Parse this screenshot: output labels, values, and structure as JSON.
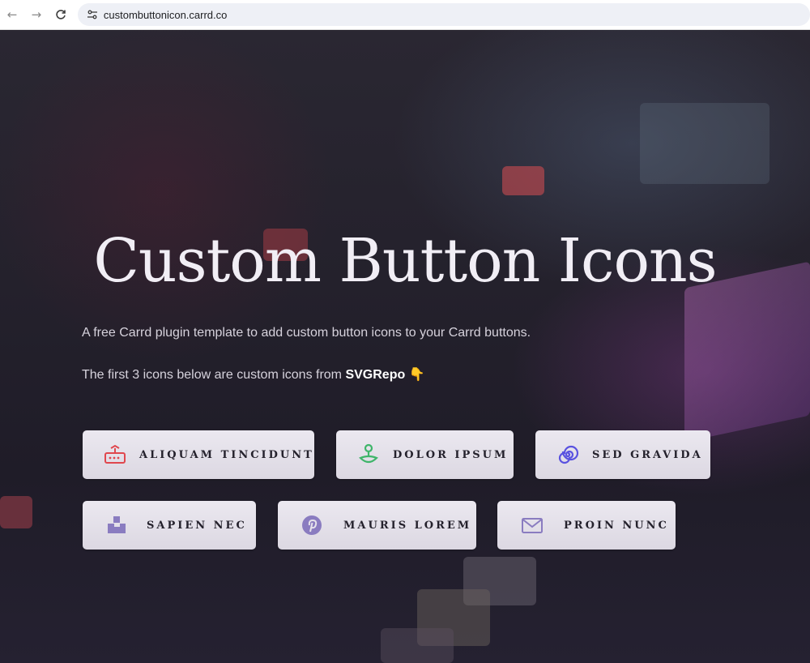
{
  "browser": {
    "url": "custombuttonicon.carrd.co"
  },
  "hero": {
    "title": "Custom Button Icons",
    "intro": "A free Carrd plugin template to add custom button icons to your Carrd buttons.",
    "note_prefix": "The first 3 icons below are custom icons from ",
    "note_link": "SVGRepo",
    "note_emoji": "👇"
  },
  "buttons": [
    {
      "label": "ALIQUAM TINCIDUNT",
      "icon": "router-icon",
      "color": "#e0474e"
    },
    {
      "label": "DOLOR IPSUM",
      "icon": "joystick-icon",
      "color": "#3fb56a"
    },
    {
      "label": "SED GRAVIDA",
      "icon": "spiral-icon",
      "color": "#5a52e0"
    },
    {
      "label": "SAPIEN NEC",
      "icon": "blocks-icon",
      "color": "#8a7cc0"
    },
    {
      "label": "MAURIS LOREM",
      "icon": "pinterest-icon",
      "color": "#8a7cc0"
    },
    {
      "label": "PROIN NUNC",
      "icon": "envelope-icon",
      "color": "#8a7cc0"
    }
  ]
}
